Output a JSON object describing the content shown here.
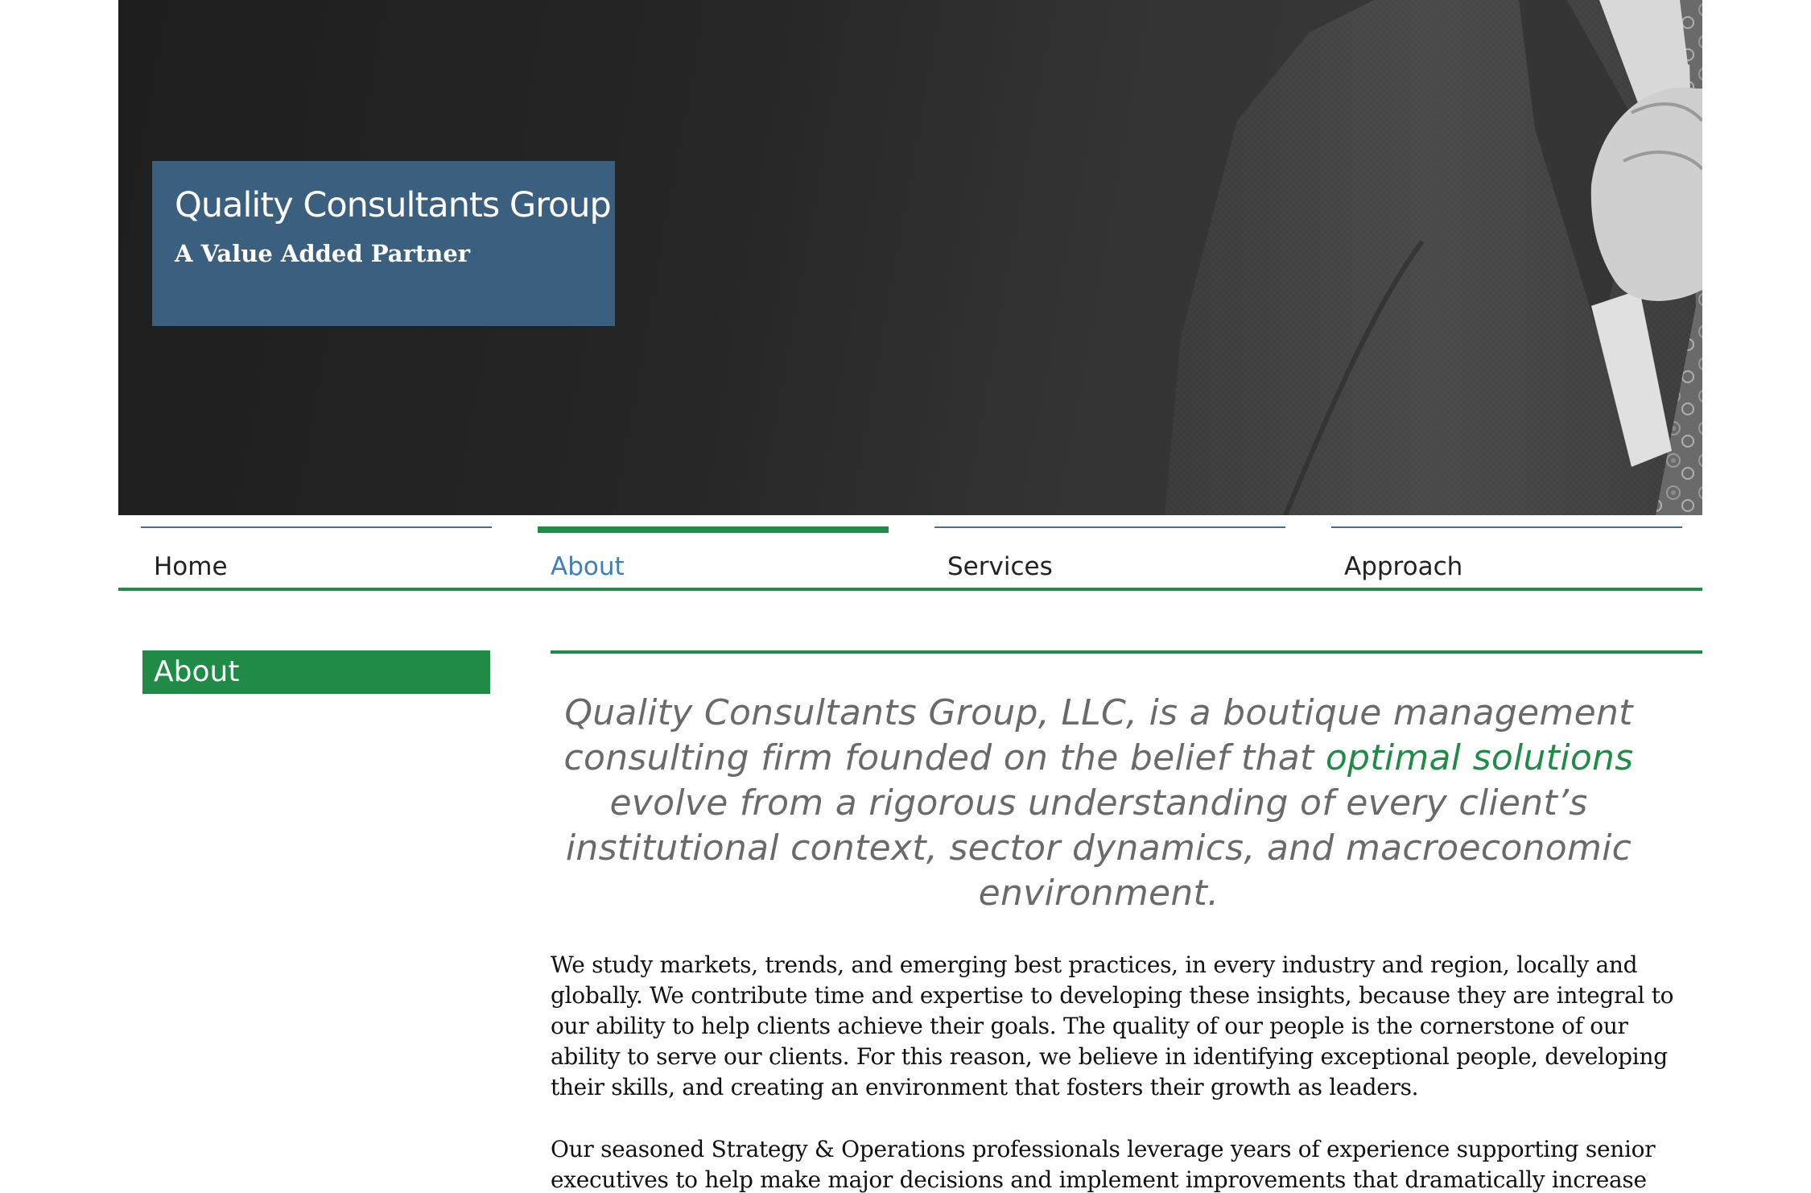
{
  "hero": {
    "title": "Quality Consultants Group",
    "tagline": "A Value Added Partner",
    "image": "man-in-suit-adjusting-tie-photo"
  },
  "nav": {
    "items": [
      {
        "label": "Home",
        "active": false
      },
      {
        "label": "About",
        "active": true
      },
      {
        "label": "Services",
        "active": false
      },
      {
        "label": "Approach",
        "active": false
      }
    ]
  },
  "sidebar": {
    "heading": "About"
  },
  "main": {
    "lead_part1": "Quality Consultants Group, LLC, is a boutique management consulting firm founded on the belief that ",
    "lead_highlight": "optimal solutions",
    "lead_part2": " evolve from a rigorous understanding of every client’s institutional context, sector dynamics, and macroeconomic environment.",
    "paragraph1": "We study markets, trends, and emerging best practices, in every industry and region, locally and globally. We contribute time and expertise to developing these insights, because they are integral to our ability to help clients achieve their goals. The quality of our people is the cornerstone of our ability to serve our clients. For this reason, we believe in identifying exceptional people, developing their skills, and creating an environment that fosters their growth as leaders.",
    "paragraph2": "Our seasoned Strategy & Operations professionals leverage years of experience supporting senior executives to help make major decisions and implement improvements that dramatically increase the"
  },
  "colors": {
    "accent_green": "#1f8b47",
    "title_box_blue": "#3b5f7f",
    "nav_blue": "#3d6fa2",
    "active_link_blue": "#3d7fb8"
  }
}
